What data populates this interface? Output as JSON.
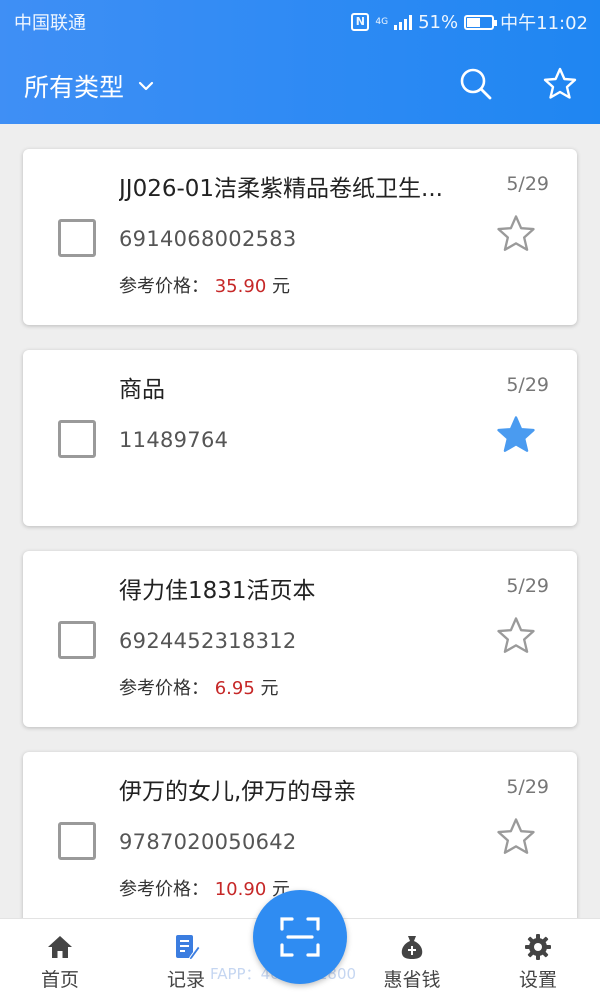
{
  "status_bar": {
    "carrier": "中国联通",
    "network": "4G",
    "battery": "51%",
    "time": "中午11:02"
  },
  "header": {
    "filter_label": "所有类型",
    "search_icon": "search-icon",
    "favorites_icon": "star-outline-icon"
  },
  "items": [
    {
      "name": "JJ026-01洁柔紫精品卷纸卫生...",
      "date": "5/29",
      "code": "6914068002583",
      "price_label": "参考价格：",
      "price": "35.90",
      "unit": "元",
      "starred": false
    },
    {
      "name": "商品",
      "date": "5/29",
      "code": "11489764",
      "price_label": "",
      "price": "",
      "unit": "",
      "starred": true
    },
    {
      "name": "得力佳1831活页本",
      "date": "5/29",
      "code": "6924452318312",
      "price_label": "参考价格：",
      "price": "6.95",
      "unit": "元",
      "starred": false
    },
    {
      "name": "伊万的女儿,伊万的母亲",
      "date": "5/29",
      "code": "9787020050642",
      "price_label": "参考价格：",
      "price": "10.90",
      "unit": "元",
      "starred": false
    }
  ],
  "bottom_nav": {
    "home": "首页",
    "records": "记录",
    "save_money": "惠省钱",
    "settings": "设置",
    "watermark": "FAPP：4008891800"
  },
  "colors": {
    "header_blue": "#2f8cf2",
    "price_red": "#c62828",
    "star_blue": "#4a9bf0",
    "active_tab": "#3b7de0"
  }
}
